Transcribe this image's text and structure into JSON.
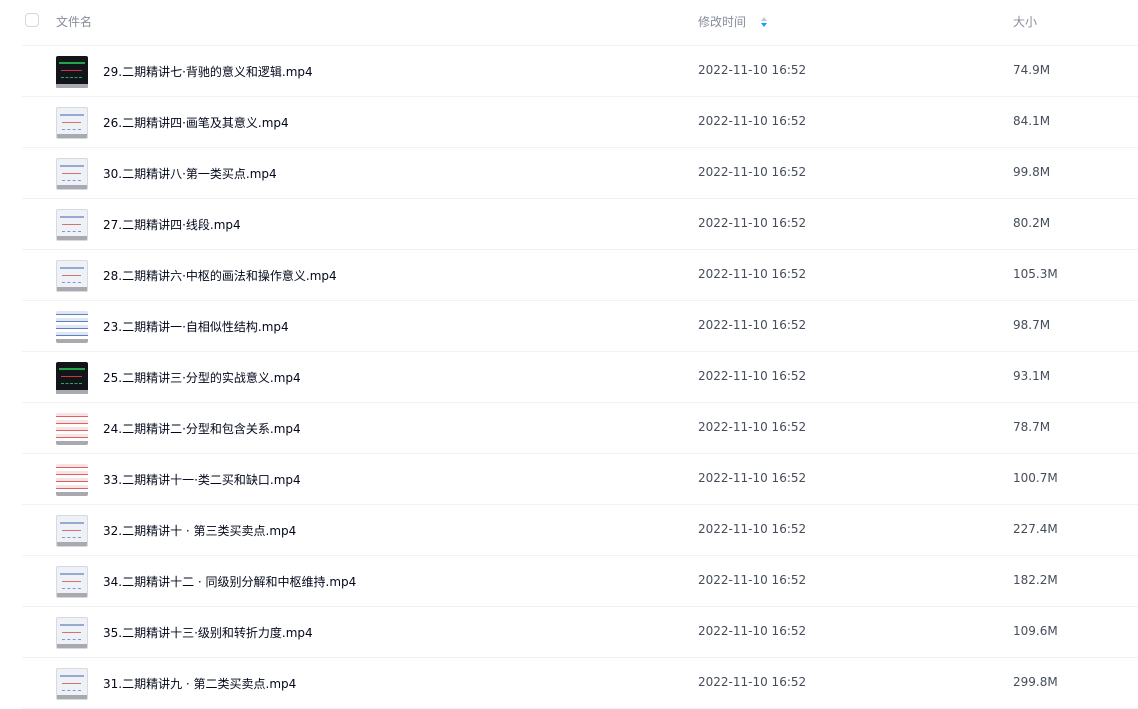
{
  "header": {
    "name_label": "文件名",
    "time_label": "修改时间",
    "size_label": "大小",
    "sort_icon": "sort-descending-icon",
    "accent_color": "#06a7ff"
  },
  "files": [
    {
      "name": "29.二期精讲七·背驰的意义和逻辑.mp4",
      "time": "2022-11-10 16:52",
      "size": "74.9M",
      "thumb": "dark"
    },
    {
      "name": "26.二期精讲四·画笔及其意义.mp4",
      "time": "2022-11-10 16:52",
      "size": "84.1M",
      "thumb": "light"
    },
    {
      "name": "30.二期精讲八·第一类买点.mp4",
      "time": "2022-11-10 16:52",
      "size": "99.8M",
      "thumb": "light"
    },
    {
      "name": "27.二期精讲四·线段.mp4",
      "time": "2022-11-10 16:52",
      "size": "80.2M",
      "thumb": "light"
    },
    {
      "name": "28.二期精讲六·中枢的画法和操作意义.mp4",
      "time": "2022-11-10 16:52",
      "size": "105.3M",
      "thumb": "light"
    },
    {
      "name": "23.二期精讲一·自相似性结构.mp4",
      "time": "2022-11-10 16:52",
      "size": "98.7M",
      "thumb": "blue"
    },
    {
      "name": "25.二期精讲三·分型的实战意义.mp4",
      "time": "2022-11-10 16:52",
      "size": "93.1M",
      "thumb": "dark"
    },
    {
      "name": "24.二期精讲二·分型和包含关系.mp4",
      "time": "2022-11-10 16:52",
      "size": "78.7M",
      "thumb": "red"
    },
    {
      "name": "33.二期精讲十一·类二买和缺口.mp4",
      "time": "2022-11-10 16:52",
      "size": "100.7M",
      "thumb": "red"
    },
    {
      "name": "32.二期精讲十 · 第三类买卖点.mp4",
      "time": "2022-11-10 16:52",
      "size": "227.4M",
      "thumb": "light"
    },
    {
      "name": "34.二期精讲十二 · 同级别分解和中枢维持.mp4",
      "time": "2022-11-10 16:52",
      "size": "182.2M",
      "thumb": "light"
    },
    {
      "name": "35.二期精讲十三·级别和转折力度.mp4",
      "time": "2022-11-10 16:52",
      "size": "109.6M",
      "thumb": "light"
    },
    {
      "name": "31.二期精讲九 · 第二类买卖点.mp4",
      "time": "2022-11-10 16:52",
      "size": "299.8M",
      "thumb": "light"
    }
  ]
}
